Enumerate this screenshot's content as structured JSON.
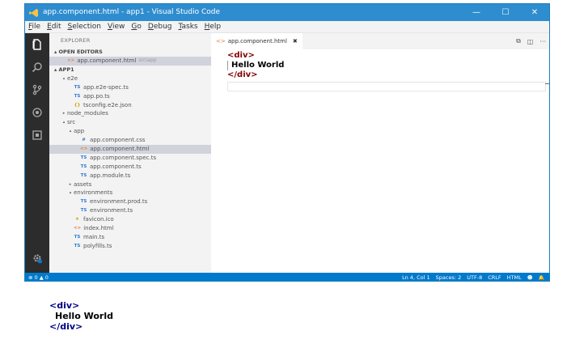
{
  "window": {
    "title": "app.component.html - app1 - Visual Studio Code",
    "minimize_glyph": "—",
    "maximize_glyph": "☐",
    "close_glyph": "✕"
  },
  "menu": [
    "File",
    "Edit",
    "Selection",
    "View",
    "Go",
    "Debug",
    "Tasks",
    "Help"
  ],
  "activity_icons": [
    "files-icon",
    "search-icon",
    "source-control-icon",
    "debug-icon",
    "extensions-icon",
    "settings-gear-icon"
  ],
  "sidebar": {
    "header": "EXPLORER",
    "open_editors": {
      "label": "▴ OPEN EDITORS",
      "items": [
        {
          "icon": "<>",
          "name": "app.component.html",
          "hint": "src\\app"
        }
      ]
    },
    "project_label": "▴ APP1",
    "tree": [
      {
        "depth": 1,
        "twisty": "▴",
        "icon": "",
        "name": "e2e"
      },
      {
        "depth": 2,
        "twisty": "",
        "icon": "TS",
        "name": "app.e2e-spec.ts"
      },
      {
        "depth": 2,
        "twisty": "",
        "icon": "TS",
        "name": "app.po.ts"
      },
      {
        "depth": 2,
        "twisty": "",
        "icon": "{}",
        "name": "tsconfig.e2e.json"
      },
      {
        "depth": 1,
        "twisty": "▸",
        "icon": "",
        "name": "node_modules"
      },
      {
        "depth": 1,
        "twisty": "▴",
        "icon": "",
        "name": "src"
      },
      {
        "depth": 2,
        "twisty": "▴",
        "icon": "",
        "name": "app"
      },
      {
        "depth": 3,
        "twisty": "",
        "icon": "#",
        "name": "app.component.css"
      },
      {
        "depth": 3,
        "twisty": "",
        "icon": "<>",
        "name": "app.component.html",
        "selected": true
      },
      {
        "depth": 3,
        "twisty": "",
        "icon": "TS",
        "name": "app.component.spec.ts"
      },
      {
        "depth": 3,
        "twisty": "",
        "icon": "TS",
        "name": "app.component.ts"
      },
      {
        "depth": 3,
        "twisty": "",
        "icon": "TS",
        "name": "app.module.ts"
      },
      {
        "depth": 2,
        "twisty": "▸",
        "icon": "",
        "name": "assets"
      },
      {
        "depth": 2,
        "twisty": "▴",
        "icon": "",
        "name": "environments"
      },
      {
        "depth": 3,
        "twisty": "",
        "icon": "TS",
        "name": "environment.prod.ts"
      },
      {
        "depth": 3,
        "twisty": "",
        "icon": "TS",
        "name": "environment.ts"
      },
      {
        "depth": 2,
        "twisty": "",
        "icon": "★",
        "name": "favicon.ico"
      },
      {
        "depth": 2,
        "twisty": "",
        "icon": "<>",
        "name": "index.html"
      },
      {
        "depth": 2,
        "twisty": "",
        "icon": "TS",
        "name": "main.ts"
      },
      {
        "depth": 2,
        "twisty": "",
        "icon": "TS",
        "name": "polyfills.ts"
      }
    ]
  },
  "editor": {
    "tab_icon": "<>",
    "tab_label": "app.component.html",
    "tab_close": "✖",
    "actions": [
      "⧉",
      "◫",
      "···"
    ],
    "lines": [
      "<div>",
      "Hello World",
      "</div>"
    ]
  },
  "statusbar": {
    "problems": "⊗ 0  ▲ 0",
    "position": "Ln 4, Col 1",
    "spaces": "Spaces: 2",
    "encoding": "UTF-8",
    "eol": "CRLF",
    "language": "HTML",
    "feedback_glyph": "☻",
    "bell_glyph": "🔔"
  },
  "preview": {
    "lines": [
      "<div>",
      "Hello World",
      "</div>"
    ]
  },
  "colors": {
    "titlebar": "#2e8dcf",
    "statusbar": "#007acc",
    "activitybar": "#2c2c2c",
    "sidebar": "#f3f3f3",
    "tag": "#800000",
    "preview_tag": "#000088"
  }
}
